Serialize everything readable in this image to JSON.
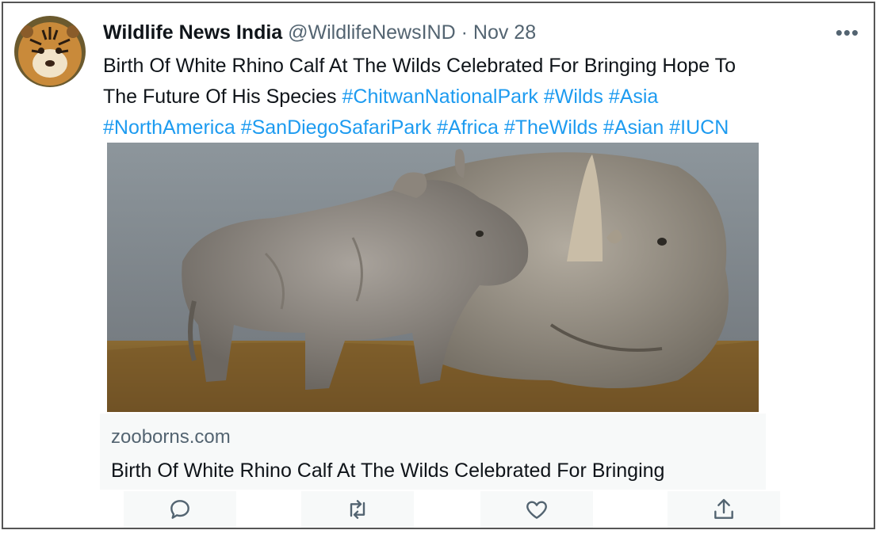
{
  "tweet": {
    "author_name": "Wildlife News India",
    "handle": "@WildlifeNewsIND",
    "separator": "·",
    "date": "Nov 28",
    "more_label": "•••",
    "text_line1": "Birth Of White Rhino Calf At The Wilds Celebrated For Bringing Hope To",
    "text_line2_plain": "The Future Of His Species ",
    "hashtags_line2": [
      "#ChitwanNationalPark",
      "#Wilds",
      "#Asia"
    ],
    "hashtags_line3": [
      "#NorthAmerica",
      "#SanDiegoSafariPark",
      "#Africa",
      "#TheWilds",
      "#Asian",
      "#IUCN"
    ]
  },
  "card": {
    "domain": "zooborns.com",
    "title": "Birth Of White Rhino Calf At The Wilds Celebrated For Bringing"
  },
  "actions": [
    {
      "name": "reply",
      "icon": "reply-icon"
    },
    {
      "name": "retweet",
      "icon": "retweet-icon"
    },
    {
      "name": "like",
      "icon": "like-icon"
    },
    {
      "name": "share",
      "icon": "share-icon"
    }
  ],
  "colors": {
    "text": "#0f1419",
    "secondary": "#536471",
    "hashtag": "#1d9bf0",
    "card_bg": "#f7f9f9"
  }
}
